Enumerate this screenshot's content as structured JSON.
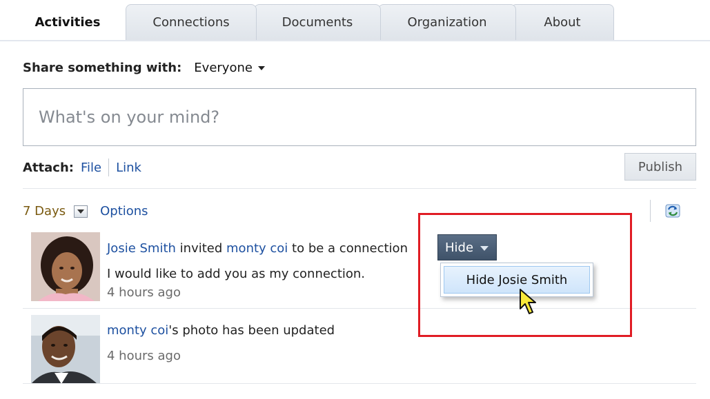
{
  "tabs": [
    "Activities",
    "Connections",
    "Documents",
    "Organization",
    "About"
  ],
  "share": {
    "label": "Share something with:",
    "value": "Everyone"
  },
  "status": {
    "placeholder": "What's on your mind?"
  },
  "attach": {
    "label": "Attach:",
    "file": "File",
    "link": "Link"
  },
  "publish_label": "Publish",
  "filter": {
    "days": "7 Days",
    "options": "Options"
  },
  "activities": [
    {
      "actor": "Josie Smith",
      "verb": " invited ",
      "target": "monty coi",
      "tail": " to be a connection",
      "message": "I would like to add you as my connection.",
      "time": "4 hours ago"
    },
    {
      "actor": "monty coi",
      "tail": "'s photo has been updated",
      "time": "4 hours ago"
    }
  ],
  "hide_menu": {
    "button": "Hide",
    "item": "Hide Josie Smith"
  },
  "colors": {
    "link": "#1d50a0",
    "highlight": "#e01c24",
    "days": "#7a5a10"
  }
}
